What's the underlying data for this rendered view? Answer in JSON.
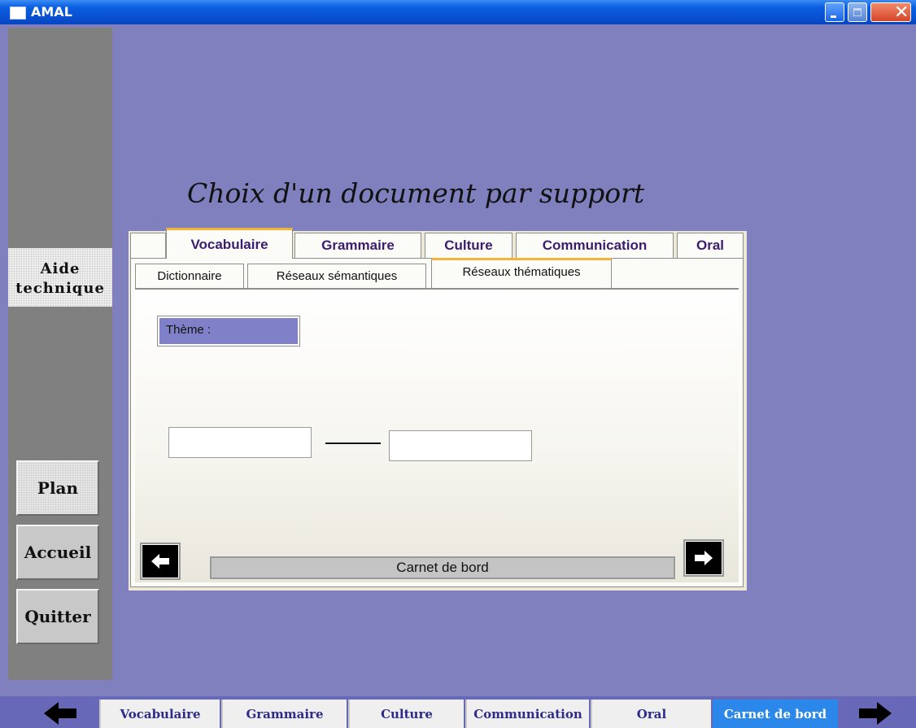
{
  "window": {
    "title": "AMAL"
  },
  "sidebar": {
    "aide_line1": "Aide",
    "aide_line2": "technique",
    "plan": "Plan",
    "accueil": "Accueil",
    "quitter": "Quitter"
  },
  "heading": "Choix d'un document par support",
  "main_tabs": [
    "Vocabulaire",
    "Grammaire",
    "Culture",
    "Communication",
    "Oral"
  ],
  "active_main_tab": "Vocabulaire",
  "sub_tabs": [
    "Dictionnaire",
    "Réseaux sémantiques",
    "Réseaux thématiques"
  ],
  "active_sub_tab": "Réseaux thématiques",
  "content": {
    "theme_label": "Thème :",
    "input1_value": "",
    "input2_value": "",
    "carnet_label": "Carnet de bord"
  },
  "bottom_tabs": [
    "Vocabulaire",
    "Grammaire",
    "Culture",
    "Communication",
    "Oral",
    "Carnet de bord"
  ],
  "active_bottom_tab": "Carnet de bord",
  "colors": {
    "background": "#8080bf",
    "titlebar": "#0a5fe0",
    "tab_text": "#3c1c6e",
    "tab_highlight": "#f3b33a",
    "active_bottom_tab": "#2b88ea"
  }
}
